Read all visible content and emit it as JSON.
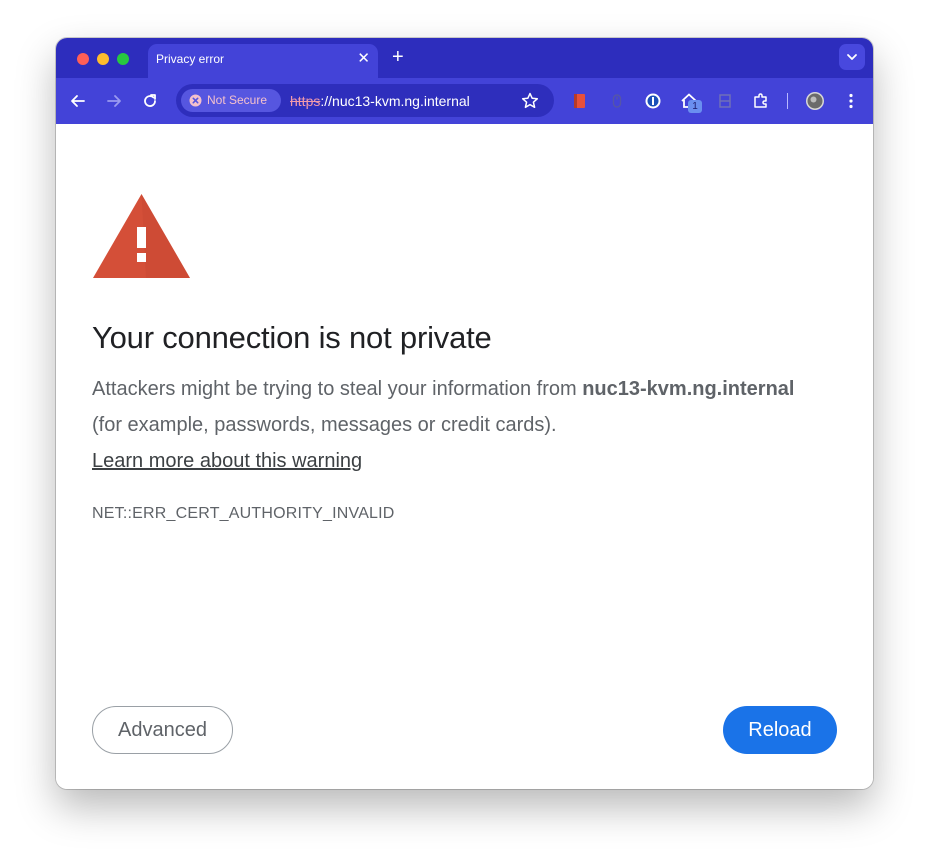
{
  "tab": {
    "title": "Privacy error",
    "close_icon": "close-icon",
    "new_tab_icon": "plus-icon"
  },
  "toolbar": {
    "security_chip": "Not Secure",
    "url_scheme": "https",
    "url_rest": "://nuc13-kvm.ng.internal",
    "extension_badge": "1"
  },
  "page": {
    "heading": "Your connection is not private",
    "desc_pre": "Attackers might be trying to steal your information from ",
    "desc_host": "nuc13-kvm.ng.internal",
    "desc_post": " (for example, passwords, messages or credit cards).",
    "learn_more": "Learn more about this warning",
    "error_code": "NET::ERR_CERT_AUTHORITY_INVALID",
    "advanced_label": "Advanced",
    "reload_label": "Reload"
  },
  "colors": {
    "tabbar": "#2d2dbd",
    "toolbar": "#4343d8",
    "warning": "#d44f38",
    "primary_button": "#1a73e8"
  }
}
